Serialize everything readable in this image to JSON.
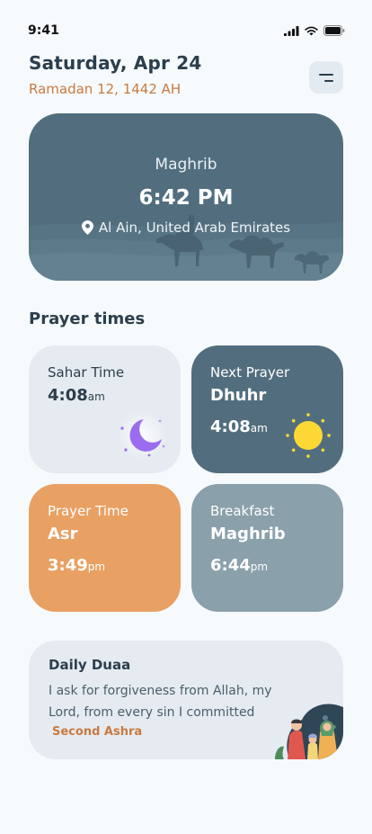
{
  "status_bar": {
    "time": "9:41"
  },
  "header": {
    "date": "Saturday, Apr 24",
    "hijri_date": "Ramadan 12, 1442 AH"
  },
  "hero": {
    "prayer": "Maghrib",
    "time": "6:42 PM",
    "location": "Al Ain, United Arab Emirates"
  },
  "section_title": "Prayer times",
  "cards": {
    "sahar": {
      "label": "Sahar Time",
      "time": "4:08",
      "period": "am"
    },
    "next": {
      "label": "Next Prayer",
      "prayer": "Dhuhr",
      "time": "4:08",
      "period": "am"
    },
    "asr": {
      "label": "Prayer Time",
      "prayer": "Asr",
      "time": "3:49",
      "period": "pm"
    },
    "breakfast": {
      "label": "Breakfast",
      "prayer": "Maghrib",
      "time": "6:44",
      "period": "pm"
    }
  },
  "duaa": {
    "title": "Daily Duaa",
    "text": "I ask for forgiveness from Allah, my Lord, from every sin I committed",
    "tag": "Second Ashra"
  },
  "colors": {
    "background": "#f6fafd",
    "accent_orange": "#c97a3f",
    "slate": "#526e7e",
    "card_light": "#e5ebf0",
    "card_orange": "#e9a063",
    "card_grey": "#8aa0ab",
    "sun": "#fdd835",
    "moon": "#9b6cf0"
  },
  "icons": {
    "menu": "menu-icon",
    "location": "location-pin-icon",
    "sahar": "moon-icon",
    "next": "sun-icon",
    "signal": "signal-icon",
    "wifi": "wifi-icon",
    "battery": "battery-icon"
  }
}
